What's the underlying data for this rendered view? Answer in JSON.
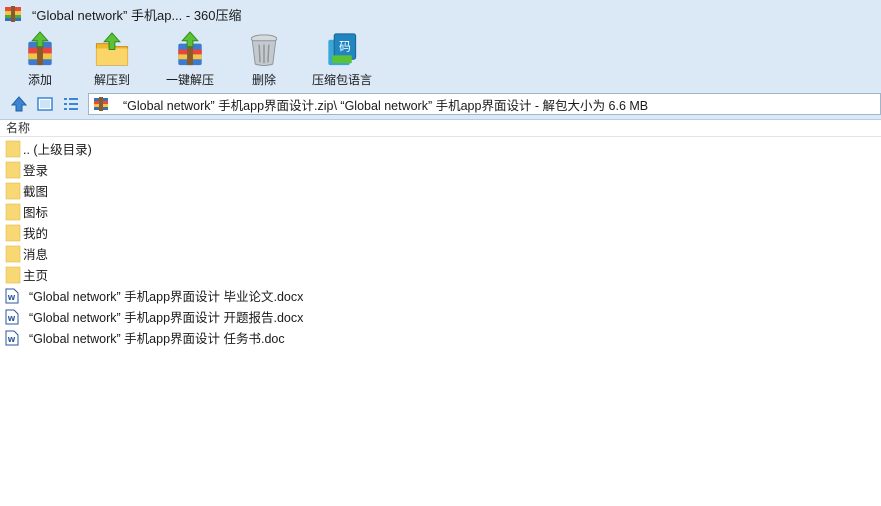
{
  "window": {
    "title": "“Global network” 手机ap... - 360压缩"
  },
  "toolbar": {
    "items": [
      {
        "label": "添加",
        "icon": "add-archive-icon"
      },
      {
        "label": "解压到",
        "icon": "extract-to-icon"
      },
      {
        "label": "一键解压",
        "icon": "one-click-extract-icon"
      },
      {
        "label": "删除",
        "icon": "trash-icon"
      },
      {
        "label": "压缩包语言",
        "icon": "archive-language-icon"
      }
    ]
  },
  "nav": {
    "buttons": [
      "up-arrow-icon",
      "view-thumbnail-icon",
      "view-list-icon"
    ],
    "address": "“Global network” 手机app界面设计.zip\\ “Global network” 手机app界面设计 - 解包大小为 6.6 MB"
  },
  "list": {
    "header": "名称",
    "items": [
      {
        "name": ".. (上级目录)",
        "type": "folder"
      },
      {
        "name": "登录",
        "type": "folder"
      },
      {
        "name": "截图",
        "type": "folder"
      },
      {
        "name": "图标",
        "type": "folder"
      },
      {
        "name": "我的",
        "type": "folder"
      },
      {
        "name": "消息",
        "type": "folder"
      },
      {
        "name": "主页",
        "type": "folder"
      },
      {
        "name": "“Global network” 手机app界面设计 毕业论文.docx",
        "type": "doc"
      },
      {
        "name": "“Global network” 手机app界面设计 开题报告.docx",
        "type": "doc"
      },
      {
        "name": "“Global network” 手机app界面设计 任务书.doc",
        "type": "doc"
      }
    ]
  },
  "colors": {
    "chrome": "#dbe9f7",
    "folder": "#f8d775",
    "doc_accent": "#2b5797"
  }
}
